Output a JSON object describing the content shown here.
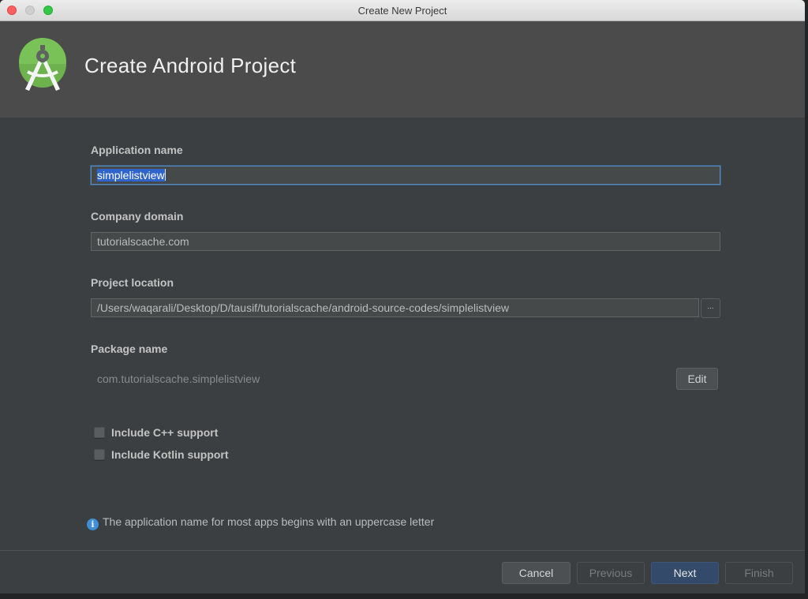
{
  "window": {
    "title": "Create New Project"
  },
  "header": {
    "title": "Create Android Project",
    "logo": "android-studio-logo-icon"
  },
  "form": {
    "application_name": {
      "label": "Application name",
      "value": "simplelistview"
    },
    "company_domain": {
      "label": "Company domain",
      "value": "tutorialscache.com"
    },
    "project_location": {
      "label": "Project location",
      "value": "/Users/waqarali/Desktop/D/tausif/tutorialscache/android-source-codes/simplelistview",
      "browse_label": "..."
    },
    "package_name": {
      "label": "Package name",
      "value": "com.tutorialscache.simplelistview",
      "edit_label": "Edit"
    },
    "options": [
      {
        "label": "Include C++ support",
        "checked": false
      },
      {
        "label": "Include Kotlin support",
        "checked": false
      }
    ]
  },
  "info": {
    "icon": "info-icon",
    "glyph": "i",
    "message": "The application name for most apps begins with an uppercase letter"
  },
  "footer": {
    "cancel": "Cancel",
    "previous": "Previous",
    "next": "Next",
    "finish": "Finish"
  },
  "colors": {
    "header_bg": "#4b4b4b",
    "body_bg": "#3c3f41",
    "selection": "#2f65ca",
    "focus_border": "#5a88bb",
    "primary_button": "#344a6b",
    "android_green": "#78c257"
  }
}
